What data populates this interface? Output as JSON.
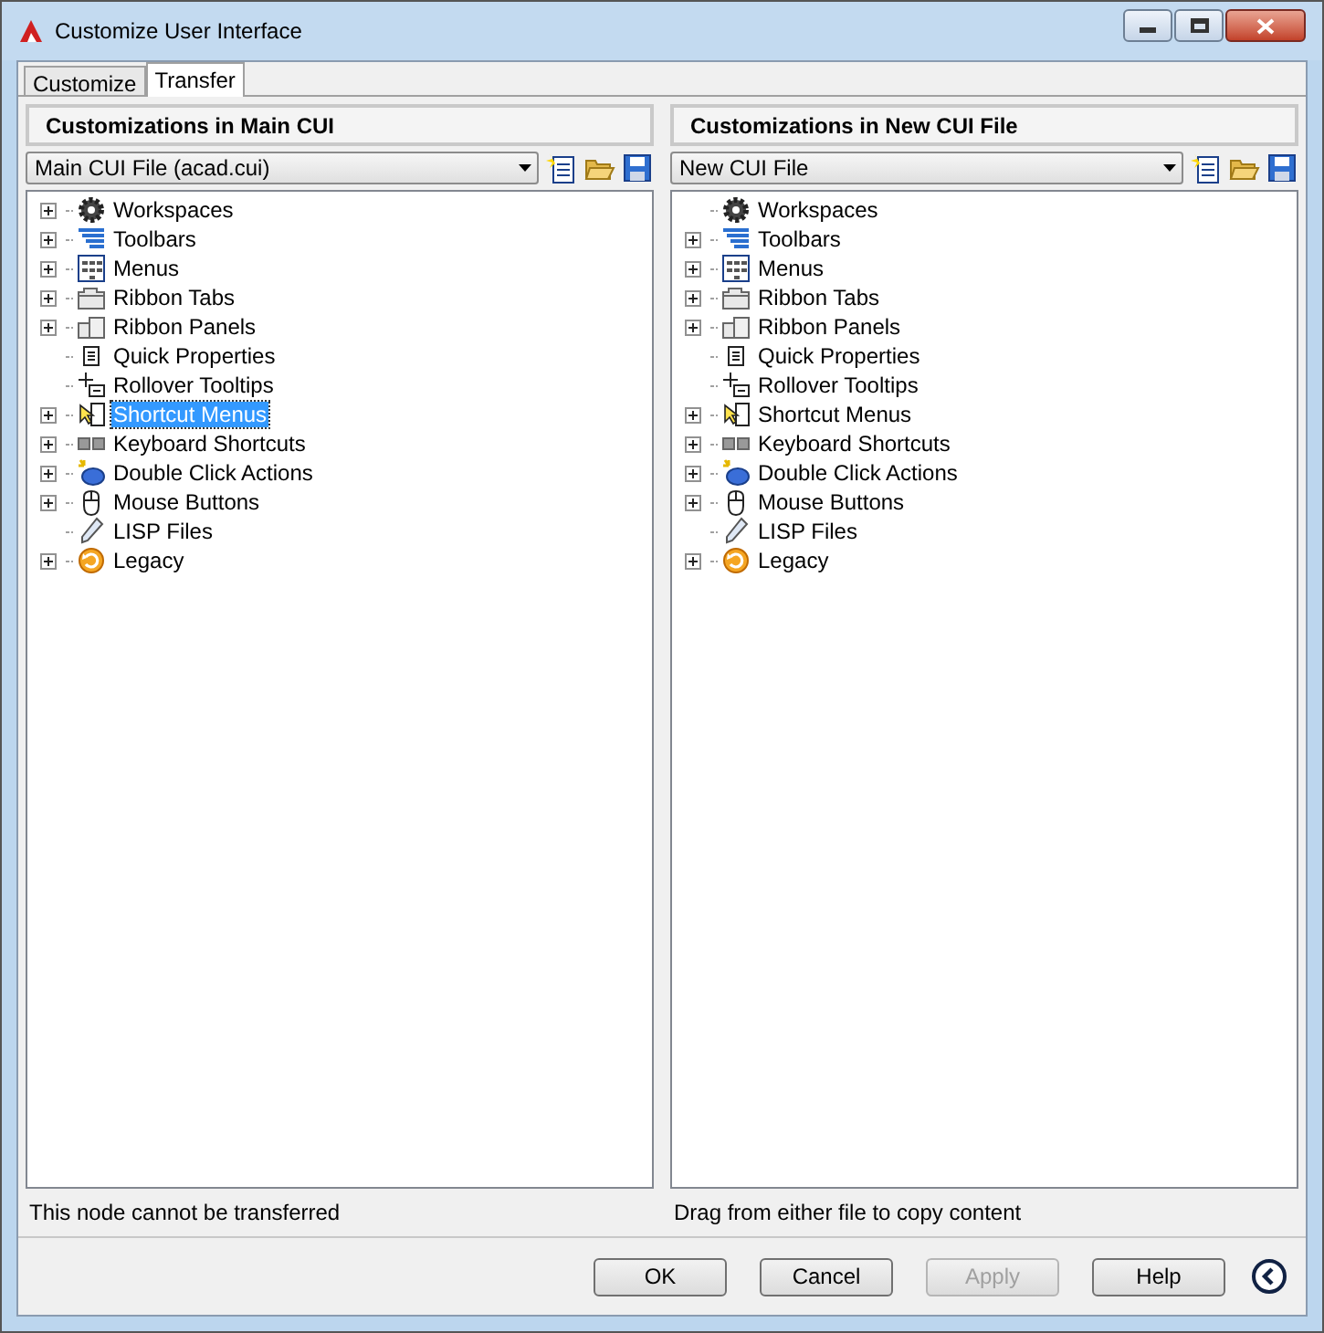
{
  "window": {
    "title": "Customize User Interface"
  },
  "tabs": [
    {
      "label": "Customize",
      "selected": false
    },
    {
      "label": "Transfer",
      "selected": true
    }
  ],
  "panels": [
    {
      "heading": "Customizations in Main CUI",
      "file": "Main CUI File (acad.cui)",
      "status": "This node cannot be transferred",
      "items": [
        {
          "label": "Workspaces",
          "kind": "workspaces",
          "expandable": true,
          "selected": false
        },
        {
          "label": "Toolbars",
          "kind": "toolbars",
          "expandable": true,
          "selected": false
        },
        {
          "label": "Menus",
          "kind": "menus",
          "expandable": true,
          "selected": false
        },
        {
          "label": "Ribbon Tabs",
          "kind": "ribbon-tabs",
          "expandable": true,
          "selected": false
        },
        {
          "label": "Ribbon Panels",
          "kind": "ribbon-panels",
          "expandable": true,
          "selected": false
        },
        {
          "label": "Quick Properties",
          "kind": "quick-properties",
          "expandable": false,
          "selected": false
        },
        {
          "label": "Rollover Tooltips",
          "kind": "rollover-tooltips",
          "expandable": false,
          "selected": false
        },
        {
          "label": "Shortcut Menus",
          "kind": "shortcut-menus",
          "expandable": true,
          "selected": true
        },
        {
          "label": "Keyboard Shortcuts",
          "kind": "keyboard-shortcuts",
          "expandable": true,
          "selected": false
        },
        {
          "label": "Double Click Actions",
          "kind": "double-click",
          "expandable": true,
          "selected": false
        },
        {
          "label": "Mouse Buttons",
          "kind": "mouse-buttons",
          "expandable": true,
          "selected": false
        },
        {
          "label": "LISP Files",
          "kind": "lisp-files",
          "expandable": false,
          "selected": false
        },
        {
          "label": "Legacy",
          "kind": "legacy",
          "expandable": true,
          "selected": false
        }
      ]
    },
    {
      "heading": "Customizations in New CUI File",
      "file": "New CUI File",
      "status": "Drag from either file to copy content",
      "items": [
        {
          "label": "Workspaces",
          "kind": "workspaces",
          "expandable": false,
          "selected": false
        },
        {
          "label": "Toolbars",
          "kind": "toolbars",
          "expandable": true,
          "selected": false
        },
        {
          "label": "Menus",
          "kind": "menus",
          "expandable": true,
          "selected": false
        },
        {
          "label": "Ribbon Tabs",
          "kind": "ribbon-tabs",
          "expandable": true,
          "selected": false
        },
        {
          "label": "Ribbon Panels",
          "kind": "ribbon-panels",
          "expandable": true,
          "selected": false
        },
        {
          "label": "Quick Properties",
          "kind": "quick-properties",
          "expandable": false,
          "selected": false
        },
        {
          "label": "Rollover Tooltips",
          "kind": "rollover-tooltips",
          "expandable": false,
          "selected": false
        },
        {
          "label": "Shortcut Menus",
          "kind": "shortcut-menus",
          "expandable": true,
          "selected": false
        },
        {
          "label": "Keyboard Shortcuts",
          "kind": "keyboard-shortcuts",
          "expandable": true,
          "selected": false
        },
        {
          "label": "Double Click Actions",
          "kind": "double-click",
          "expandable": true,
          "selected": false
        },
        {
          "label": "Mouse Buttons",
          "kind": "mouse-buttons",
          "expandable": true,
          "selected": false
        },
        {
          "label": "LISP Files",
          "kind": "lisp-files",
          "expandable": false,
          "selected": false
        },
        {
          "label": "Legacy",
          "kind": "legacy",
          "expandable": true,
          "selected": false
        }
      ]
    }
  ],
  "buttons": [
    {
      "label": "OK",
      "disabled": false
    },
    {
      "label": "Cancel",
      "disabled": false
    },
    {
      "label": "Apply",
      "disabled": true
    },
    {
      "label": "Help",
      "disabled": false
    }
  ]
}
